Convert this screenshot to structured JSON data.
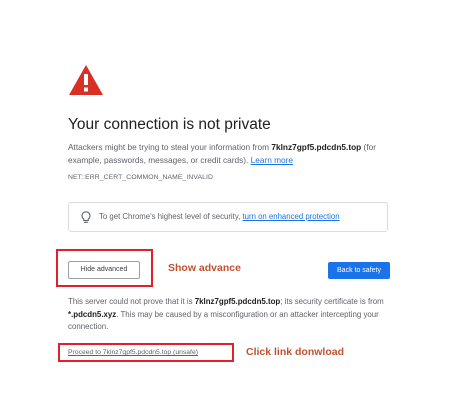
{
  "page": {
    "title": "Your connection is not private",
    "description": {
      "prefix": "Attackers might be trying to steal your information from ",
      "domain": "7klnz7gpf5.pdcdn5.top",
      "suffix": " (for example, passwords, messages, or credit cards). ",
      "learn_more": "Learn more"
    },
    "error_code": "NET::ERR_CERT_COMMON_NAME_INVALID",
    "enhanced": {
      "prefix": "To get Chrome's highest level of security, ",
      "link": "turn on enhanced protection"
    },
    "buttons": {
      "hide_advanced": "Hide advanced",
      "back_to_safety": "Back to safety"
    },
    "details": {
      "prefix": "This server could not prove that it is ",
      "domain": "7klnz7gpf5.pdcdn5.top",
      "middle": "; its security certificate is from ",
      "cert_domain": "*.pdcdn5.xyz",
      "suffix": ". This may be caused by a misconfiguration or an attacker intercepting your connection."
    },
    "proceed_link": "Proceed to 7klnz7gpf5.pdcdn5.top (unsafe)"
  },
  "annotations": {
    "show_advance": "Show advance",
    "click_link": "Click link donwload"
  },
  "colors": {
    "warning_red": "#d93025",
    "accent_blue": "#1a73e8",
    "annotation_red": "#e0202a",
    "annotation_text": "#c0522f"
  },
  "icons": {
    "warning": "warning-triangle-icon",
    "bulb": "lightbulb-icon"
  }
}
